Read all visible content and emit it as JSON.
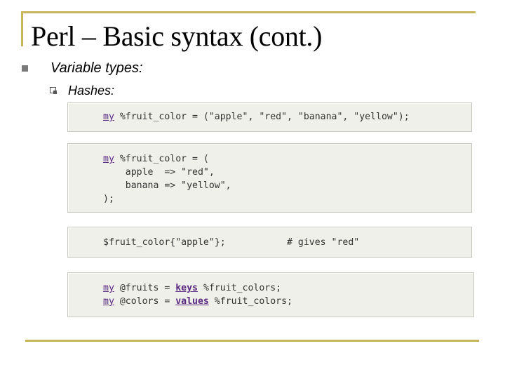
{
  "slide": {
    "title": "Perl – Basic syntax (cont.)",
    "bullet1": "Variable types:",
    "bullet2": "Hashes:"
  },
  "code": {
    "b1": {
      "kw": "my",
      "rest": " %fruit_color = (\"apple\", \"red\", \"banana\", \"yellow\");"
    },
    "b2": {
      "l1_kw": "my",
      "l1_rest": " %fruit_color = (",
      "l2": "    apple  => \"red\",",
      "l3": "    banana => \"yellow\",",
      "l4": ");"
    },
    "b3": {
      "line": "$fruit_color{\"apple\"};           # gives \"red\""
    },
    "b4": {
      "l1_kw": "my",
      "l1_a": " @fruits = ",
      "l1_fn": "keys",
      "l1_b": " %fruit_colors;",
      "l2_kw": "my",
      "l2_a": " @colors = ",
      "l2_fn": "values",
      "l2_b": " %fruit_colors;"
    }
  }
}
